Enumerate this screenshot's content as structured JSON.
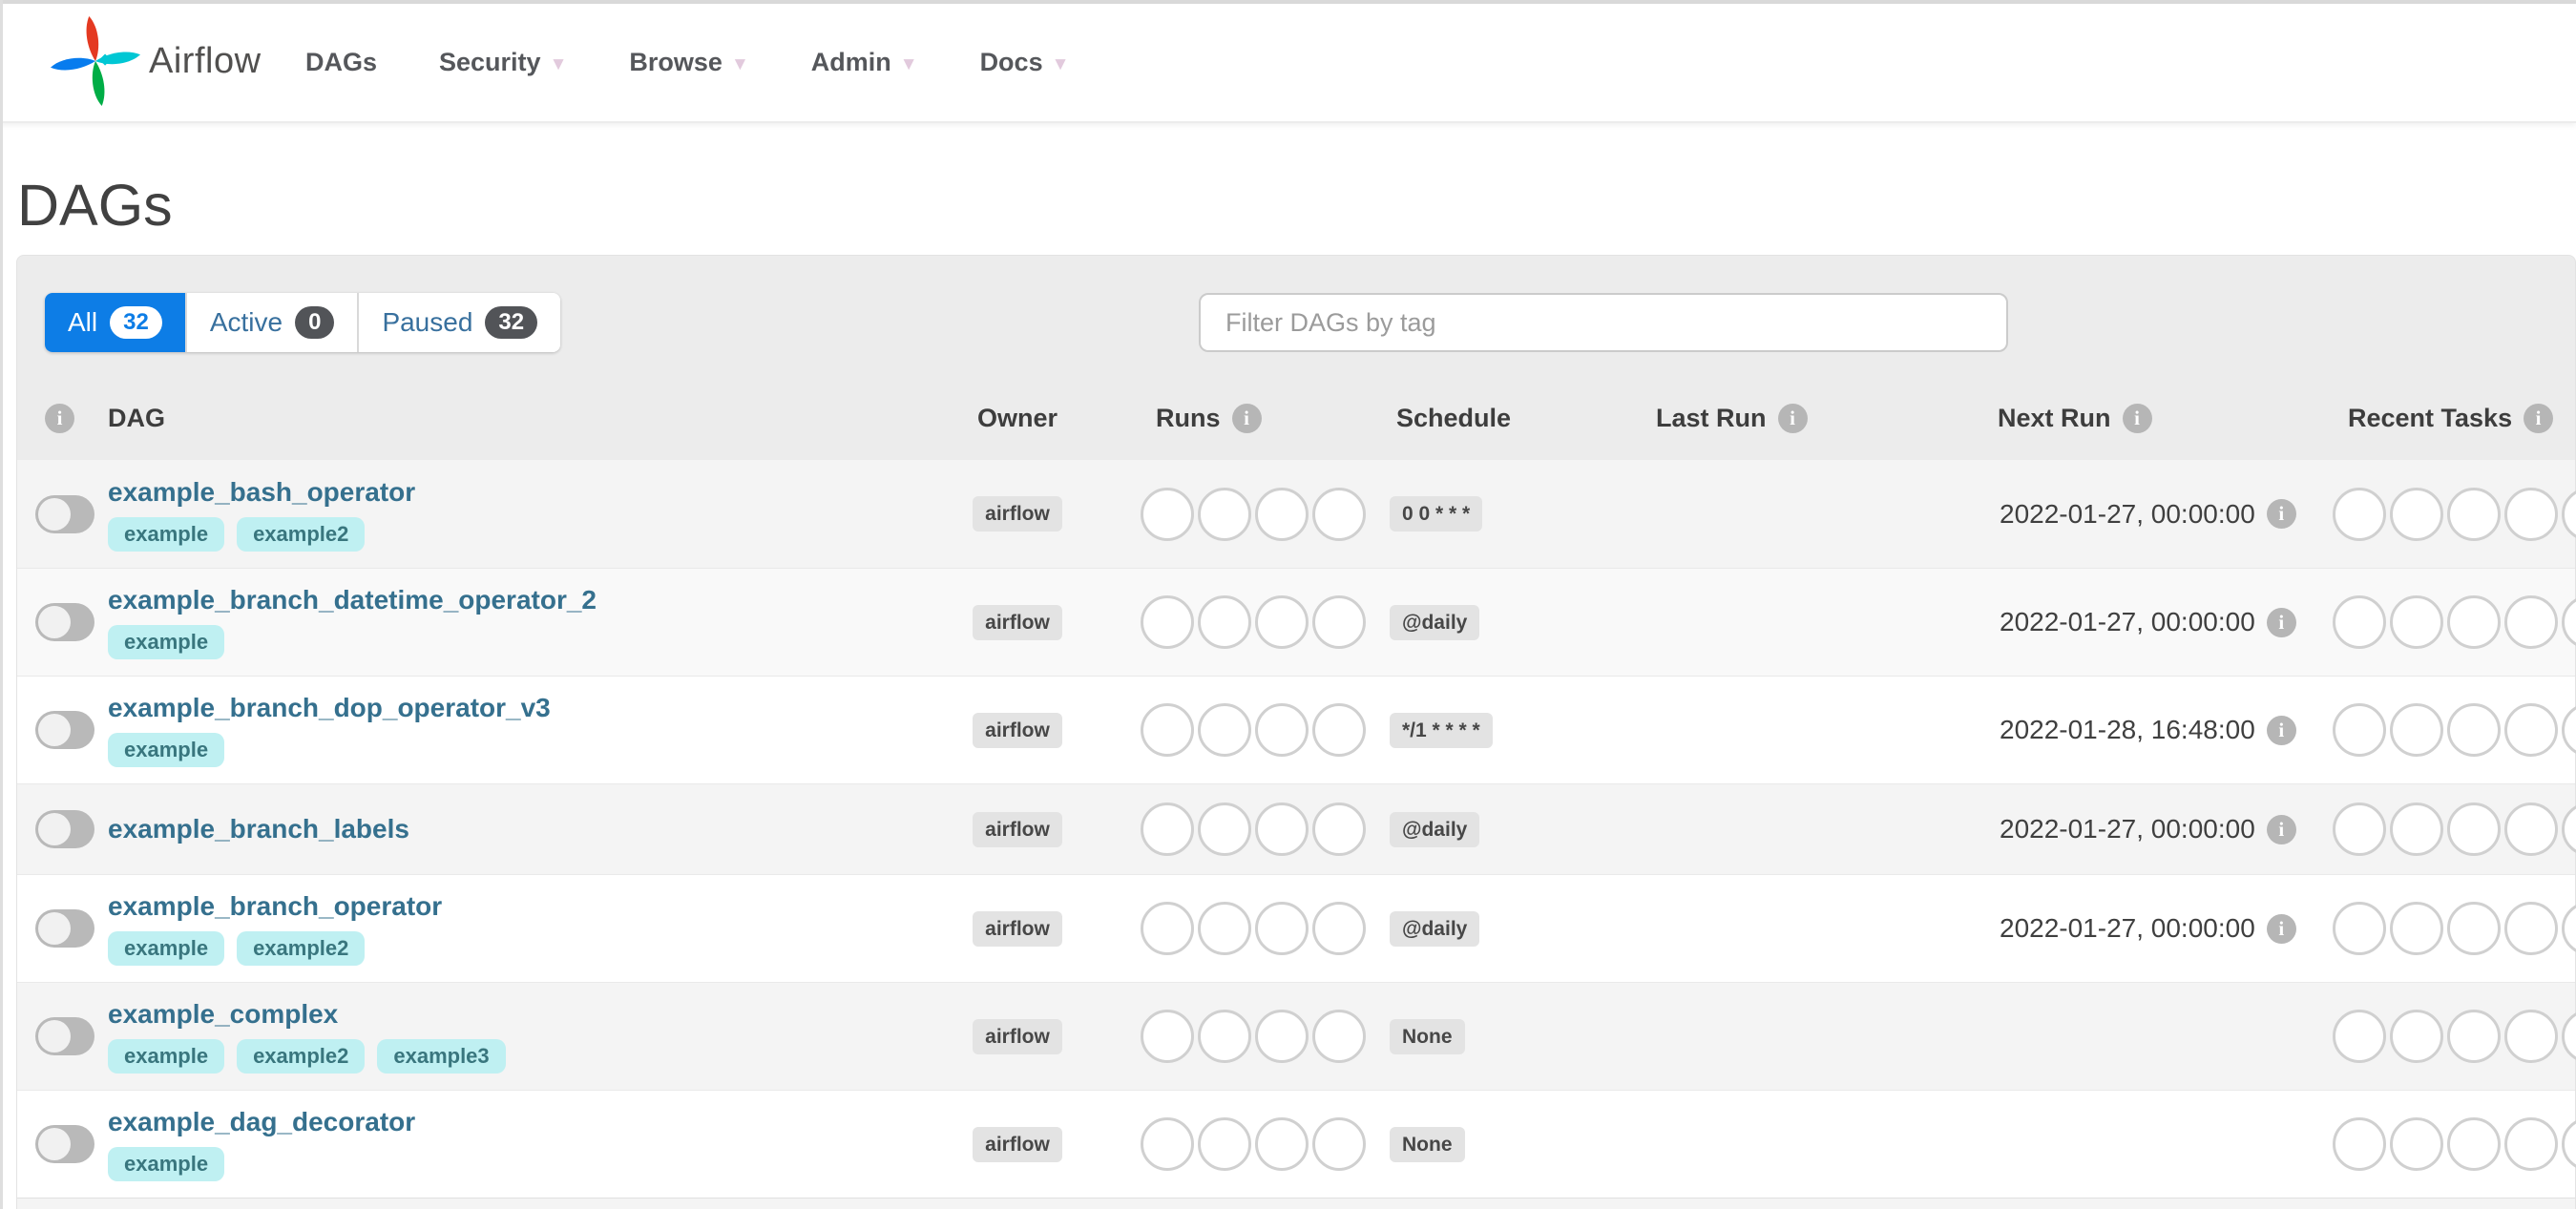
{
  "nav": {
    "brand": "Airflow",
    "items": [
      {
        "label": "DAGs",
        "has_caret": false
      },
      {
        "label": "Security",
        "has_caret": true
      },
      {
        "label": "Browse",
        "has_caret": true
      },
      {
        "label": "Admin",
        "has_caret": true
      },
      {
        "label": "Docs",
        "has_caret": true
      }
    ]
  },
  "page": {
    "title": "DAGs"
  },
  "filters": {
    "tabs": [
      {
        "label": "All",
        "count": "32",
        "active": true
      },
      {
        "label": "Active",
        "count": "0",
        "active": false
      },
      {
        "label": "Paused",
        "count": "32",
        "active": false
      }
    ],
    "search_placeholder": "Filter DAGs by tag"
  },
  "table": {
    "columns": [
      {
        "label": "",
        "info_icon": true
      },
      {
        "label": "DAG",
        "info_icon": false
      },
      {
        "label": "Owner",
        "info_icon": false
      },
      {
        "label": "Runs",
        "info_icon": true
      },
      {
        "label": "Schedule",
        "info_icon": false
      },
      {
        "label": "Last Run",
        "info_icon": true
      },
      {
        "label": "Next Run",
        "info_icon": true
      },
      {
        "label": "Recent Tasks",
        "info_icon": true
      }
    ],
    "runs_slots": 4,
    "recent_tasks_slots": 5,
    "rows": [
      {
        "name": "example_bash_operator",
        "tags": [
          "example",
          "example2"
        ],
        "owner": "airflow",
        "schedule": "0 0 * * *",
        "last_run": "",
        "next_run": "2022-01-27, 00:00:00",
        "toggle": "off"
      },
      {
        "name": "example_branch_datetime_operator_2",
        "tags": [
          "example"
        ],
        "owner": "airflow",
        "schedule": "@daily",
        "last_run": "",
        "next_run": "2022-01-27, 00:00:00",
        "toggle": "off"
      },
      {
        "name": "example_branch_dop_operator_v3",
        "tags": [
          "example"
        ],
        "owner": "airflow",
        "schedule": "*/1 * * * *",
        "last_run": "",
        "next_run": "2022-01-28, 16:48:00",
        "toggle": "off"
      },
      {
        "name": "example_branch_labels",
        "tags": [],
        "owner": "airflow",
        "schedule": "@daily",
        "last_run": "",
        "next_run": "2022-01-27, 00:00:00",
        "toggle": "off"
      },
      {
        "name": "example_branch_operator",
        "tags": [
          "example",
          "example2"
        ],
        "owner": "airflow",
        "schedule": "@daily",
        "last_run": "",
        "next_run": "2022-01-27, 00:00:00",
        "toggle": "off"
      },
      {
        "name": "example_complex",
        "tags": [
          "example",
          "example2",
          "example3"
        ],
        "owner": "airflow",
        "schedule": "None",
        "last_run": "",
        "next_run": "",
        "toggle": "off"
      },
      {
        "name": "example_dag_decorator",
        "tags": [
          "example"
        ],
        "owner": "airflow",
        "schedule": "None",
        "last_run": "",
        "next_run": "",
        "toggle": "off"
      }
    ]
  },
  "colors": {
    "accent_blue": "#0d7de6",
    "dag_link_blue": "#35708e",
    "tag_bg": "#bff0f2",
    "tag_text": "#39767e",
    "badge_gray_bg": "#e3e3e3",
    "panel_gray": "#ececec",
    "count_badge_dark": "#525458"
  }
}
